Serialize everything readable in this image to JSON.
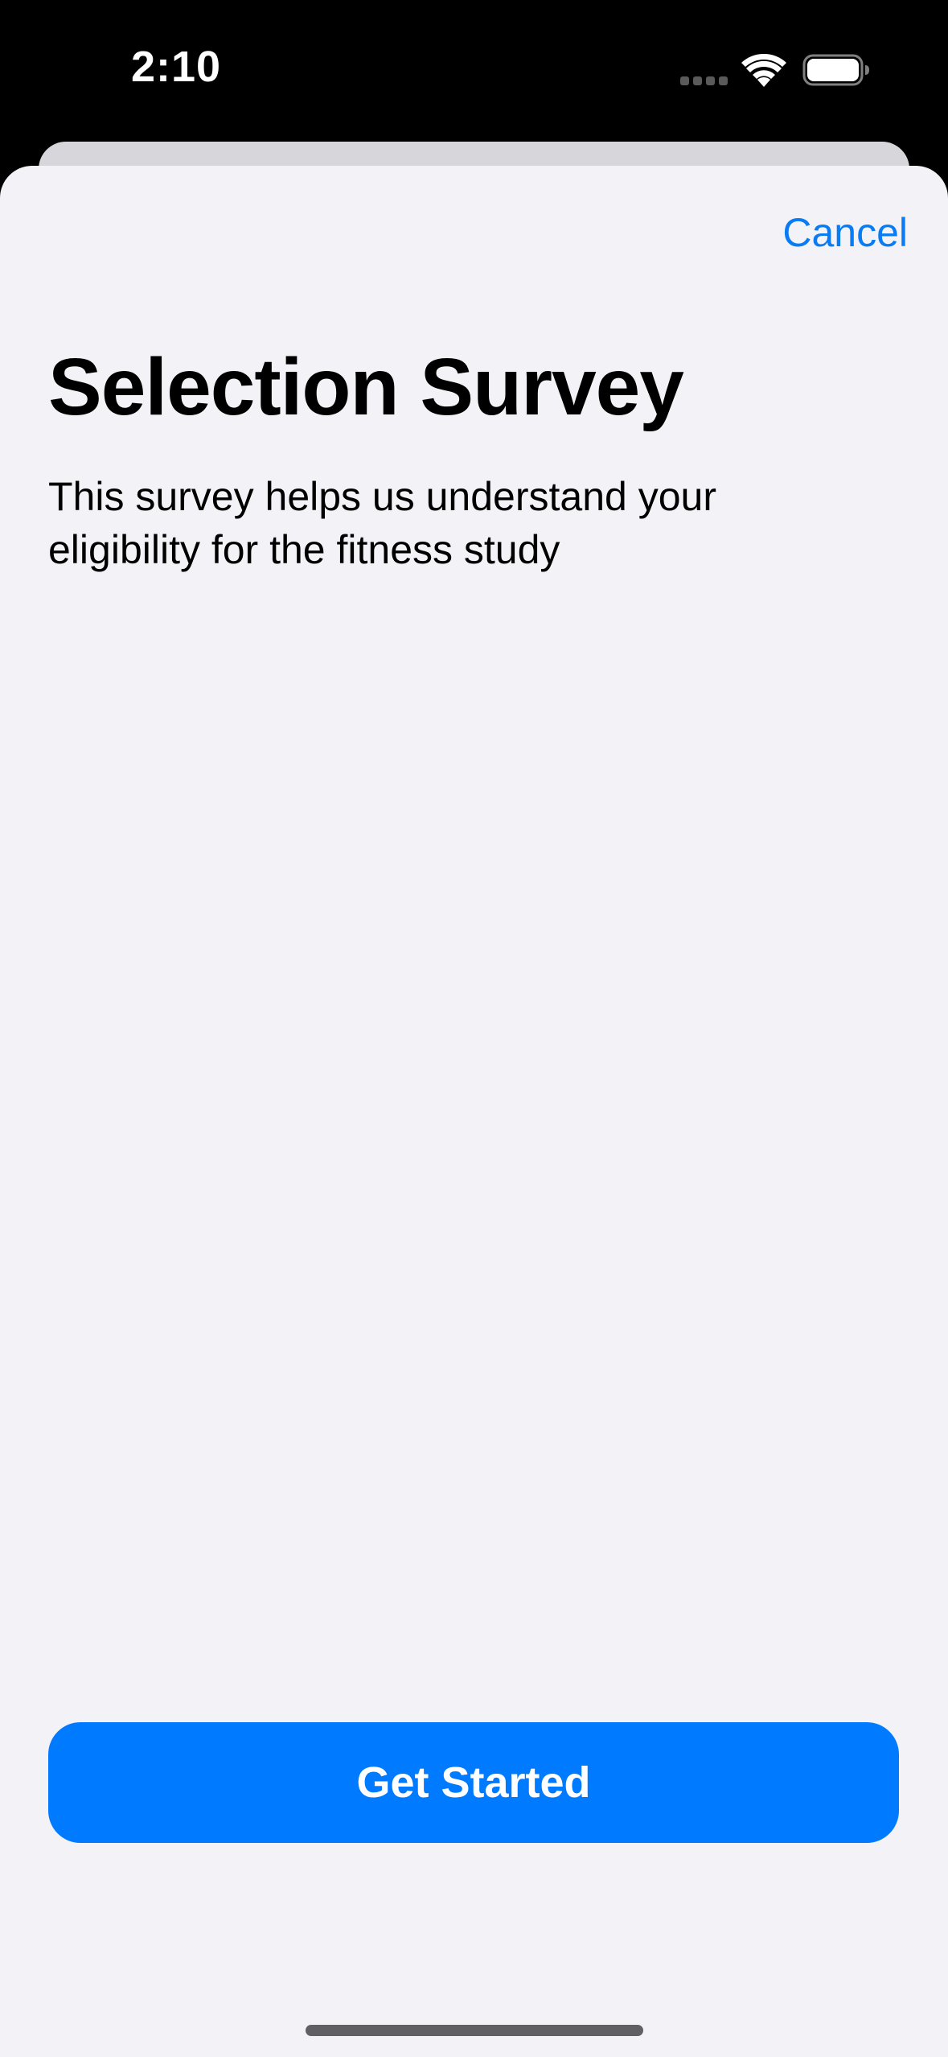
{
  "status_bar": {
    "time": "2:10",
    "icons": [
      "signal-icon",
      "wifi-icon",
      "battery-icon"
    ]
  },
  "sheet": {
    "cancel_label": "Cancel",
    "title": "Selection Survey",
    "description": "This survey helps us understand your eligibility for the fitness study",
    "primary_button_label": "Get Started"
  },
  "colors": {
    "accent": "#007aff",
    "link": "#0a7cf3",
    "sheet_background": "#f2f2f7",
    "status_bar_background": "#000000"
  }
}
